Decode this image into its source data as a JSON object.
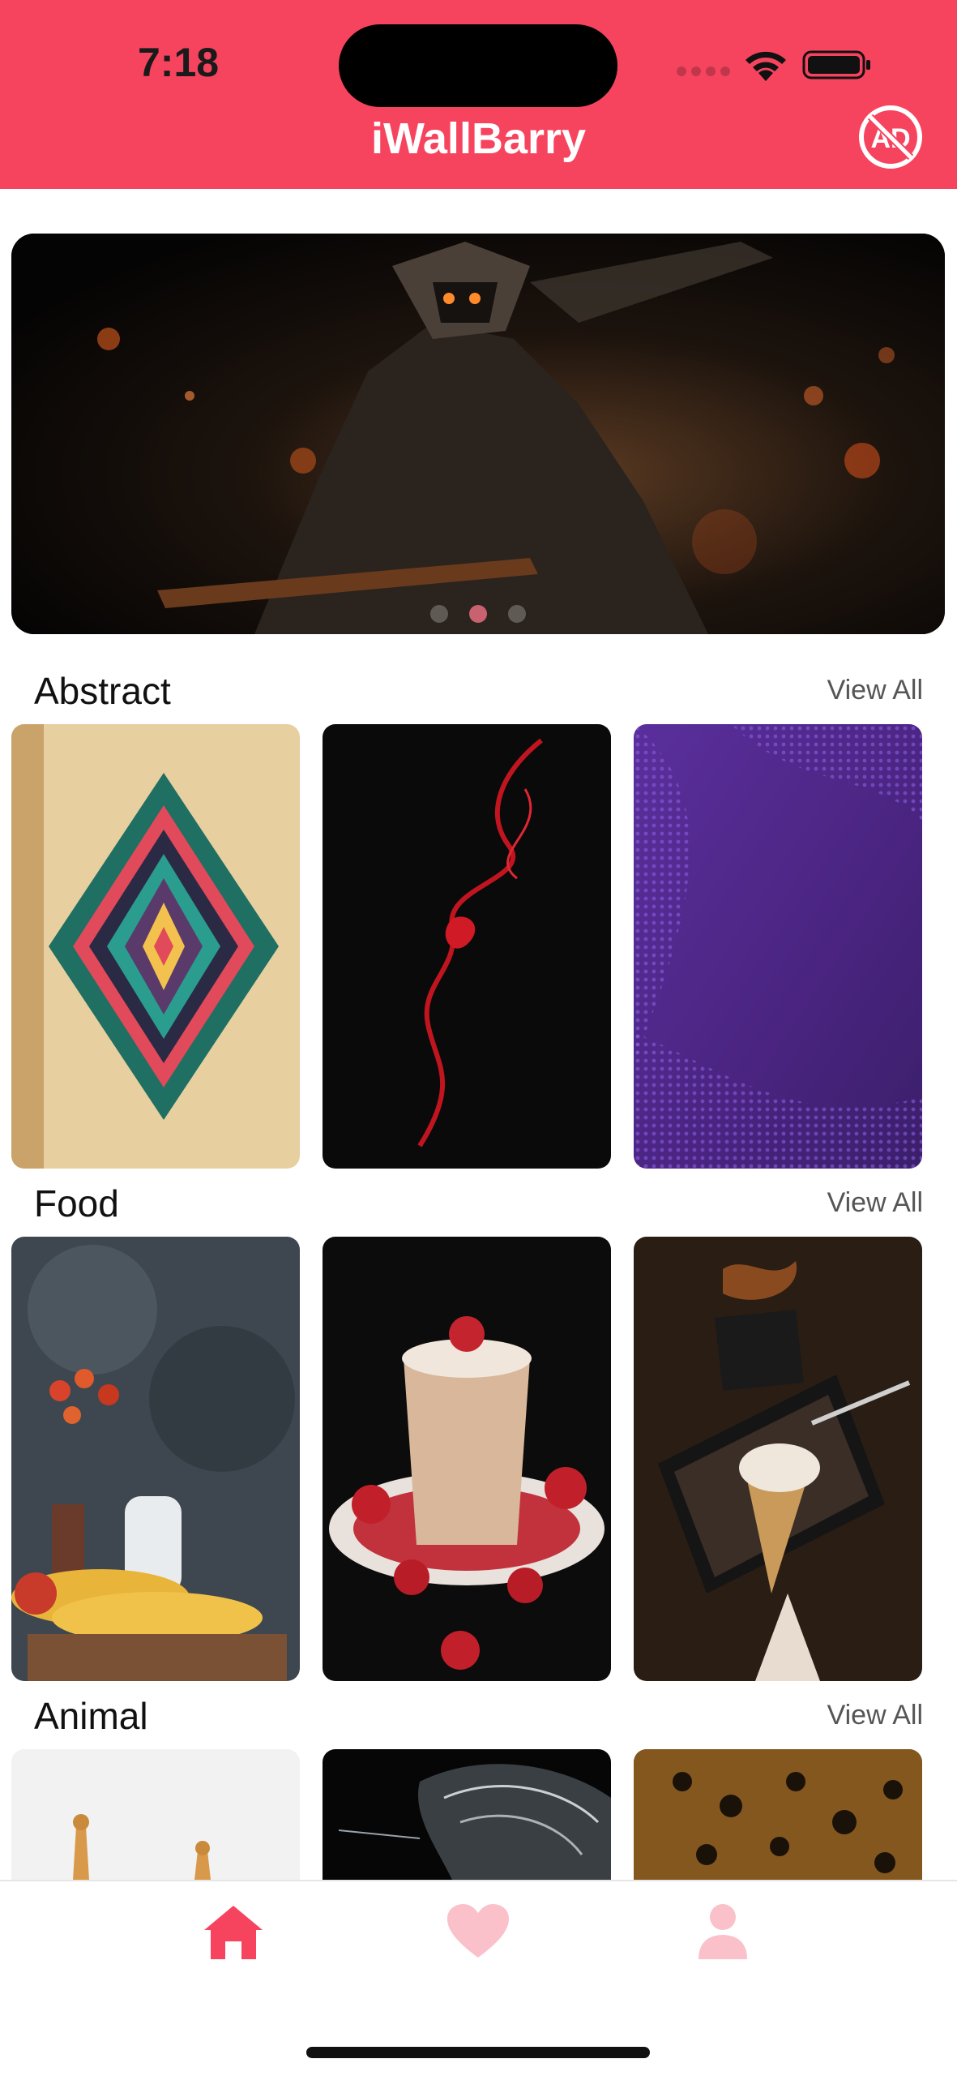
{
  "status_bar": {
    "time": "7:18"
  },
  "header": {
    "title": "iWallBarry",
    "noad_icon": "no-ads-icon"
  },
  "banner": {
    "page_count": 3,
    "active_page": 2
  },
  "sections": [
    {
      "title": "Abstract",
      "view_all": "View All"
    },
    {
      "title": "Food",
      "view_all": "View All"
    },
    {
      "title": "Animal",
      "view_all": "View All"
    }
  ],
  "tabbar": {
    "items": [
      {
        "icon": "home-icon",
        "active": true
      },
      {
        "icon": "heart-icon",
        "active": false
      },
      {
        "icon": "profile-icon",
        "active": false
      }
    ]
  },
  "colors": {
    "accent": "#f6445f",
    "accent_light": "#fbc1cb"
  }
}
